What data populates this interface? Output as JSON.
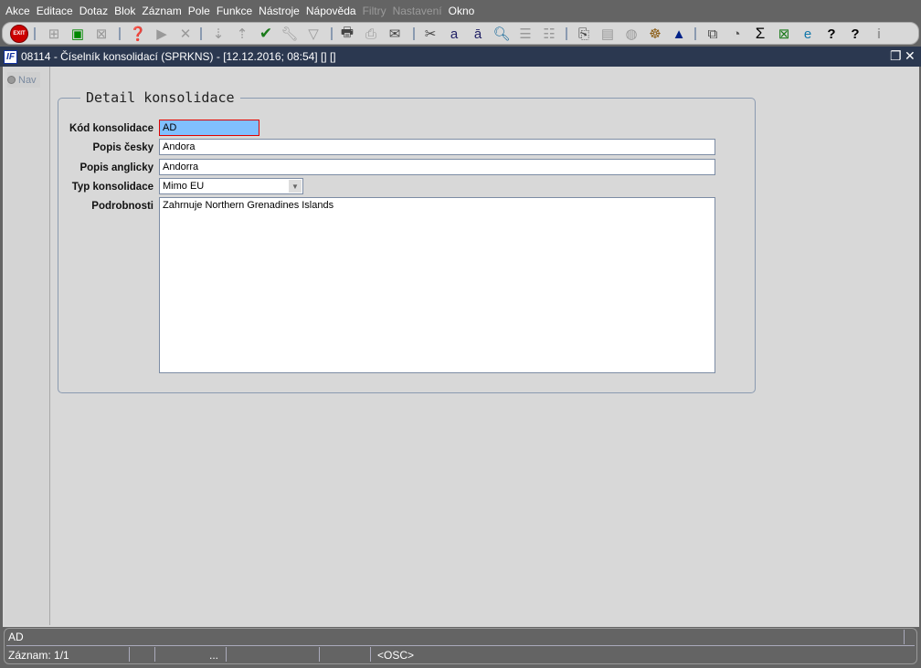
{
  "menu": [
    {
      "label": "Akce"
    },
    {
      "label": "Editace"
    },
    {
      "label": "Dotaz"
    },
    {
      "label": "Blok"
    },
    {
      "label": "Záznam"
    },
    {
      "label": "Pole"
    },
    {
      "label": "Funkce"
    },
    {
      "label": "Nástroje"
    },
    {
      "label": "Nápověda"
    },
    {
      "label": "Filtry",
      "disabled": true
    },
    {
      "label": "Nastavení",
      "disabled": true
    },
    {
      "label": "Okno"
    }
  ],
  "toolbar": {
    "exit_label": "EXIT"
  },
  "window": {
    "title": "08114 - Číselník konsolidací (SPRKNS) - [12.12.2016; 08:54]  [] []",
    "logo": "ľF"
  },
  "nav": {
    "label": "Nav"
  },
  "form": {
    "group_title": "Detail konsolidace",
    "kod_label": "Kód konsolidace",
    "kod_value": "AD",
    "popis_cz_label": "Popis česky",
    "popis_cz_value": "Andora",
    "popis_en_label": "Popis anglicky",
    "popis_en_value": "Andorra",
    "typ_label": "Typ konsolidace",
    "typ_value": "Mimo EU",
    "podrobnosti_label": "Podrobnosti",
    "podrobnosti_value": "Zahrnuje Northern Grenadines Islands"
  },
  "status": {
    "message": "AD",
    "record": "Záznam: 1/1",
    "ellipsis": "...",
    "mode": "<OSC>"
  }
}
